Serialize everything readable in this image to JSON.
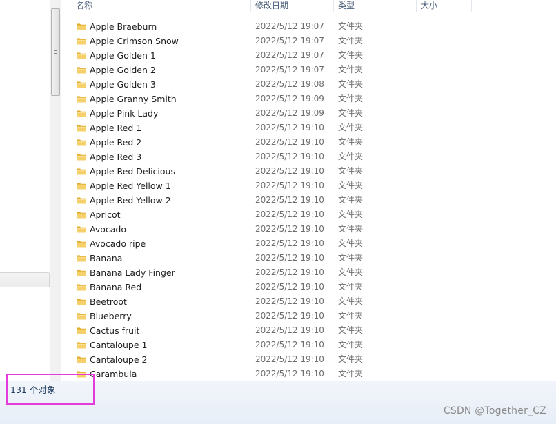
{
  "columns": {
    "name": "名称",
    "modified": "修改日期",
    "type": "类型",
    "size": "大小"
  },
  "files": [
    {
      "name": "Apple Braeburn",
      "modified": "2022/5/12 19:07",
      "type": "文件夹"
    },
    {
      "name": "Apple Crimson Snow",
      "modified": "2022/5/12 19:07",
      "type": "文件夹"
    },
    {
      "name": "Apple Golden 1",
      "modified": "2022/5/12 19:07",
      "type": "文件夹"
    },
    {
      "name": "Apple Golden 2",
      "modified": "2022/5/12 19:07",
      "type": "文件夹"
    },
    {
      "name": "Apple Golden 3",
      "modified": "2022/5/12 19:08",
      "type": "文件夹"
    },
    {
      "name": "Apple Granny Smith",
      "modified": "2022/5/12 19:09",
      "type": "文件夹"
    },
    {
      "name": "Apple Pink Lady",
      "modified": "2022/5/12 19:09",
      "type": "文件夹"
    },
    {
      "name": "Apple Red 1",
      "modified": "2022/5/12 19:10",
      "type": "文件夹"
    },
    {
      "name": "Apple Red 2",
      "modified": "2022/5/12 19:10",
      "type": "文件夹"
    },
    {
      "name": "Apple Red 3",
      "modified": "2022/5/12 19:10",
      "type": "文件夹"
    },
    {
      "name": "Apple Red Delicious",
      "modified": "2022/5/12 19:10",
      "type": "文件夹"
    },
    {
      "name": "Apple Red Yellow 1",
      "modified": "2022/5/12 19:10",
      "type": "文件夹"
    },
    {
      "name": "Apple Red Yellow 2",
      "modified": "2022/5/12 19:10",
      "type": "文件夹"
    },
    {
      "name": "Apricot",
      "modified": "2022/5/12 19:10",
      "type": "文件夹"
    },
    {
      "name": "Avocado",
      "modified": "2022/5/12 19:10",
      "type": "文件夹"
    },
    {
      "name": "Avocado ripe",
      "modified": "2022/5/12 19:10",
      "type": "文件夹"
    },
    {
      "name": "Banana",
      "modified": "2022/5/12 19:10",
      "type": "文件夹"
    },
    {
      "name": "Banana Lady Finger",
      "modified": "2022/5/12 19:10",
      "type": "文件夹"
    },
    {
      "name": "Banana Red",
      "modified": "2022/5/12 19:10",
      "type": "文件夹"
    },
    {
      "name": "Beetroot",
      "modified": "2022/5/12 19:10",
      "type": "文件夹"
    },
    {
      "name": "Blueberry",
      "modified": "2022/5/12 19:10",
      "type": "文件夹"
    },
    {
      "name": "Cactus fruit",
      "modified": "2022/5/12 19:10",
      "type": "文件夹"
    },
    {
      "name": "Cantaloupe 1",
      "modified": "2022/5/12 19:10",
      "type": "文件夹"
    },
    {
      "name": "Cantaloupe 2",
      "modified": "2022/5/12 19:10",
      "type": "文件夹"
    },
    {
      "name": "Carambula",
      "modified": "2022/5/12 19:10",
      "type": "文件夹"
    }
  ],
  "status": {
    "count_text": "131 个对象"
  },
  "watermark": "CSDN @Together_CZ",
  "icons": {
    "folder": "folder-icon",
    "scroll_grip": "scrollbar-grip-icon"
  },
  "colors": {
    "highlight": "#e53bdc",
    "folder_yellow": "#f2c64a",
    "header_text": "#4c607a"
  }
}
